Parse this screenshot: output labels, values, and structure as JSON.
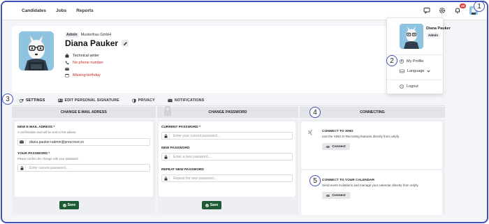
{
  "nav": {
    "items": [
      "Candidates",
      "Jobs",
      "Reports"
    ]
  },
  "topbar": {
    "notification_count": "48"
  },
  "profile": {
    "role_tag": "Admin",
    "company": "Musterfrau GmbH",
    "name": "Diana Pauker",
    "job_title": "Technical writer",
    "phone": "No phone number",
    "email": "",
    "birthday": "Missing birthday"
  },
  "user_menu": {
    "name": "Diana Pauker",
    "role": "Admin",
    "my_profile": "My Profile",
    "language": "Language",
    "logout": "Logout"
  },
  "tabs": [
    "SETTINGS",
    "EDIT PERSONAL SIGNATURE",
    "PRIVACY",
    "NOTIFICATIONS"
  ],
  "change_email": {
    "header": "CHANGE E-MAIL ADRESS",
    "new_email_label": "NEW E-MAIL ADRESS *",
    "new_email_hint": "A confirmation mail will be sent to this adress.",
    "new_email_value": "diana.pauker+admin@prescreen.io",
    "password_label": "YOUR PASSWORD *",
    "password_hint": "Please confirm the change with your password.",
    "password_placeholder": "Enter current password...",
    "save": "Save"
  },
  "change_password": {
    "header": "CHANGE PASSWORD",
    "current_label": "CURRENT PASSWORD *",
    "current_placeholder": "Enter your current password...",
    "new_label": "NEW PASSWORD",
    "new_placeholder": "Enter a new password...",
    "repeat_label": "REPEAT NEW PASSWORD",
    "repeat_placeholder": "Repeat the new password...",
    "save": "Save"
  },
  "connecting": {
    "header": "CONNECTING",
    "xing_title": "CONNECT TO XING",
    "xing_desc": "Use the XING E-Recruiting features directly from onlyfy.",
    "xing_button": "Connect",
    "calendar_title": "CONNECT TO YOUR CALENDAR",
    "calendar_desc": "Send event invitations and manage your calendar directly from onlyfy.",
    "calendar_button": "Connect"
  },
  "markers": [
    "1",
    "2",
    "3",
    "4",
    "5"
  ],
  "colors": {
    "accent": "#3f51b5",
    "save": "#1e5a36",
    "warning": "#c62828",
    "badge": "#e53935"
  }
}
